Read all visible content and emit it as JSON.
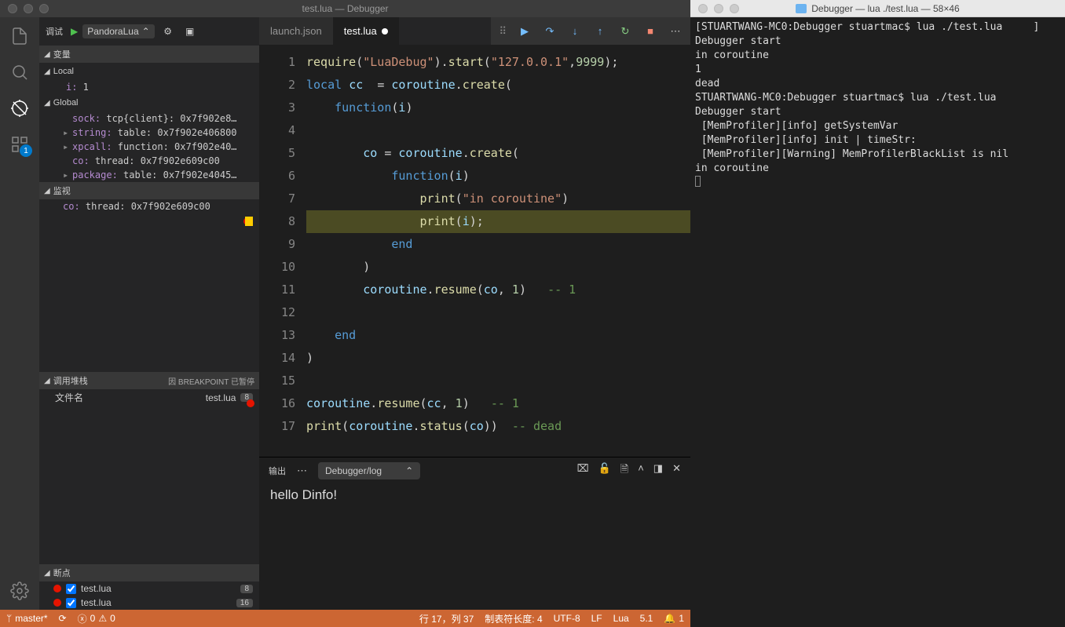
{
  "window": {
    "title": "test.lua — Debugger"
  },
  "activity": {
    "extensionsBadge": "1"
  },
  "debugHeader": {
    "label": "调试",
    "config": "PandoraLua"
  },
  "variables": {
    "title": "变量",
    "localTitle": "Local",
    "localVars": [
      {
        "name": "i:",
        "value": " 1"
      }
    ],
    "globalTitle": "Global",
    "globalVars": [
      {
        "name": "sock:",
        "value": " tcp{client}: 0x7f902e8…",
        "expand": ""
      },
      {
        "name": "string:",
        "value": " table: 0x7f902e406800",
        "expand": "▸"
      },
      {
        "name": "xpcall:",
        "value": " function: 0x7f902e40…",
        "expand": "▸"
      },
      {
        "name": "co:",
        "value": " thread: 0x7f902e609c00",
        "expand": ""
      },
      {
        "name": "package:",
        "value": " table: 0x7f902e4045…",
        "expand": "▸"
      }
    ]
  },
  "watch": {
    "title": "监视",
    "items": [
      {
        "name": "co:",
        "value": " thread: 0x7f902e609c00"
      }
    ]
  },
  "callstack": {
    "title": "调用堆栈",
    "status": "因 BREAKPOINT 已暂停",
    "fileLabel": "文件名",
    "file": "test.lua",
    "line": "8"
  },
  "breakpoints": {
    "title": "断点",
    "items": [
      {
        "file": "test.lua",
        "line": "8"
      },
      {
        "file": "test.lua",
        "line": "16"
      }
    ]
  },
  "tabs": {
    "one": "launch.json",
    "two": "test.lua"
  },
  "code": {
    "lines": "17",
    "bpCurrent": 8,
    "bpRed": 16
  },
  "panel": {
    "tab": "输出",
    "select": "Debugger/log",
    "body": "hello Dinfo!"
  },
  "statusbar": {
    "branch": "master*",
    "errs": "0",
    "warns": "0",
    "pos": "行 17，列 37",
    "tabsize": "制表符长度: 4",
    "enc": "UTF-8",
    "eol": "LF",
    "lang": "Lua",
    "ver": "5.1",
    "notif": "1"
  },
  "terminal": {
    "title": "Debugger — lua ./test.lua — 58×46",
    "lines": [
      "[STUARTWANG-MC0:Debugger stuartmac$ lua ./test.lua     ]",
      "Debugger start",
      "in coroutine",
      "1",
      "dead",
      "STUARTWANG-MC0:Debugger stuartmac$ lua ./test.lua",
      "Debugger start",
      " [MemProfiler][info] getSystemVar",
      " [MemProfiler][info] init | timeStr:",
      " [MemProfiler][Warning] MemProfilerBlackList is nil",
      "in coroutine"
    ]
  }
}
